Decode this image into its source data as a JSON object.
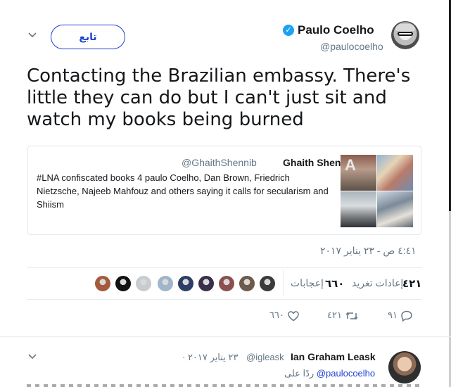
{
  "tweet": {
    "author_name": "Paulo Coelho",
    "author_handle": "@paulocoelho",
    "verified_icon": "verified-badge-icon",
    "follow_label": "تابع",
    "text": "Contacting the Brazilian embassy. There's little they can do but I can't just sit and watch my books being burned",
    "timestamp": "٤:٤١ ص - ٢٣ يناير ٢٠١٧"
  },
  "quoted": {
    "name": "Ghaith Shennib",
    "handle": "@GhaithShennib",
    "text": "#LNA confiscated books 4 paulo Coelho, Dan Brown, Friedrich Nietzsche, Najeeb Mahfouz and others saying it calls for secularism and Shiism"
  },
  "stats": {
    "retweets_count": "٤٢١",
    "retweets_label": "إعادات تغريد",
    "likes_count": "٦٦٠",
    "likes_label": "إعجابات"
  },
  "actions": {
    "reply_count": "٩١",
    "retweet_count": "٤٢١",
    "like_count": "٦٦٠"
  },
  "likers_colors": [
    "#3b3b3b",
    "#6d5a4a",
    "#8b4f4f",
    "#3a2f4b",
    "#2c3e66",
    "#9fb5c9",
    "#c8ccd1",
    "#111111",
    "#a65a3b",
    "#7b8fa6"
  ],
  "reply": {
    "name": "Ian Graham Leask",
    "handle": "@igleask",
    "date": "· ٢٣ يناير ٢٠١٧",
    "replying_prefix": "ردًا على",
    "replying_mention": "@paulocoelho"
  },
  "colors": {
    "link_blue": "#1d3fd6",
    "verified_blue": "#1da1f2",
    "muted": "#657786"
  }
}
